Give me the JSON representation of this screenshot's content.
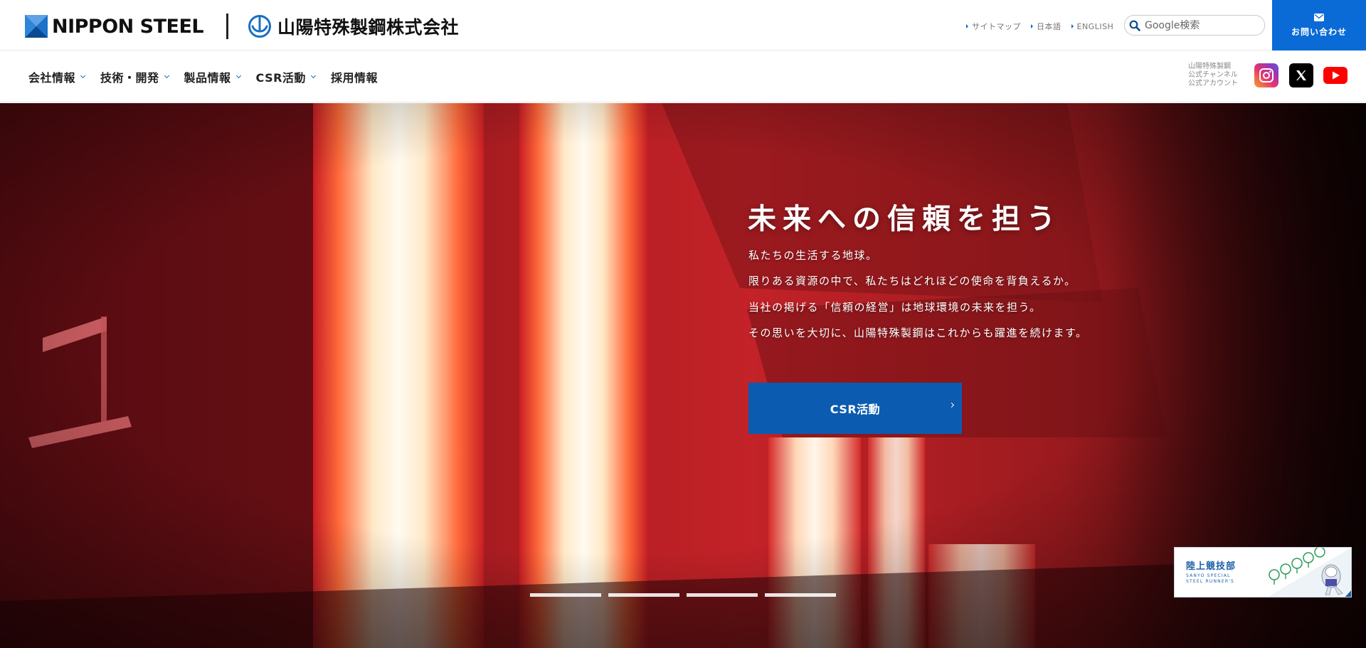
{
  "brand": {
    "parent_logo_text": "NIPPON STEEL",
    "company_logo_text": "山陽特殊製鋼株式会社",
    "colors": {
      "accent": "#0a6ad6",
      "cta": "#0b5cb0",
      "hero_red": "#c22228"
    }
  },
  "header": {
    "util_links": [
      {
        "label": "サイトマップ"
      },
      {
        "label": "日本語"
      },
      {
        "label": "ENGLISH"
      }
    ],
    "search": {
      "placeholder": "Google検索",
      "icon": "search-icon"
    },
    "contact": {
      "label": "お問い合わせ",
      "icon": "mail-icon"
    }
  },
  "nav": {
    "items": [
      {
        "label": "会社情報",
        "has_dropdown": true
      },
      {
        "label": "技術・開発",
        "has_dropdown": true
      },
      {
        "label": "製品情報",
        "has_dropdown": true
      },
      {
        "label": "CSR活動",
        "has_dropdown": true
      },
      {
        "label": "採用情報",
        "has_dropdown": false
      }
    ],
    "social_label": "山陽特殊製鋼\n公式チャンネル\n公式アカウント",
    "social": [
      {
        "name": "instagram-icon"
      },
      {
        "name": "x-icon"
      },
      {
        "name": "youtube-icon"
      }
    ]
  },
  "hero": {
    "title": "未来への信頼を担う",
    "lines": [
      "私たちの生活する地球。",
      "限りある資源の中で、私たちはどれほどの使命を背負えるか。",
      "当社の掲げる「信頼の経営」は地球環境の未来を担う。",
      "その思いを大切に、山陽特殊製鋼はこれからも躍進を続けます。"
    ],
    "cta_label": "CSR活動",
    "slide_count": 4
  },
  "banner": {
    "title": "陸上競技部",
    "subtitle": "SANYO SPECIAL STEEL RUNNER'S"
  }
}
